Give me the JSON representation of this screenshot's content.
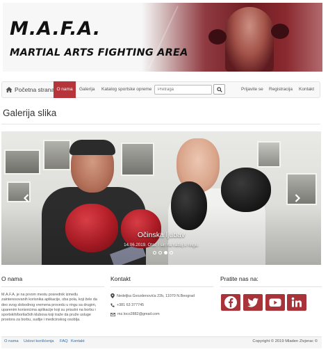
{
  "banner": {
    "title": "M.A.F.A.",
    "subtitle": "MARTIAL ARTS FIGHTING AREA"
  },
  "navbar": {
    "home_label": "Početna strana",
    "items": [
      {
        "label": "O nama",
        "active": true
      },
      {
        "label": "Galerija"
      },
      {
        "label": "Katalog sportske opreme"
      }
    ],
    "search_placeholder": "Pretraga",
    "right_items": [
      {
        "label": "Prijavite se"
      },
      {
        "label": "Registracija"
      },
      {
        "label": "Kontakt"
      }
    ]
  },
  "page_title": "Galerija slika",
  "carousel": {
    "caption_title": "Očinska ljubav",
    "caption_text": "14.06.2019. Otac i sin na našoj u ringu.",
    "slide_count": 4,
    "active_index": 2
  },
  "footer": {
    "about_title": "O nama",
    "about_text": "M.A.F.A. je na prvom mestu posrednik između zainteresovanih korisnika aplikacije, oba pola, koji žele da deo svog slobodnog vremena provedu u ringu sa drugim, uparenim korisnicima aplikacije koji su prisutni na borbu i sportskih/borilačkih klubova koji traže da pruže usluge prostora za borbu, sudije i medicinskog osoblja.",
    "contact_title": "Kontakt",
    "contact_address": "Nedeljka Gvozdenovića 22b, 11070 N.Beograd",
    "contact_phone": "+381 63 377745",
    "contact_email": "mz.loco2882@gmail.com",
    "follow_title": "Pratite nas na:",
    "social": [
      "facebook-icon",
      "twitter-icon",
      "youtube-icon",
      "linkedin-icon"
    ],
    "bottom_links": [
      "O nama",
      "Uslovi korišćenja",
      "FAQ",
      "Kontakt"
    ],
    "copyright": "Copyright © 2019 Mladen Zivjerac ©"
  },
  "colors": {
    "accent": "#b5353b",
    "social_bg": "#a8343a",
    "link": "#2d6aa8"
  }
}
